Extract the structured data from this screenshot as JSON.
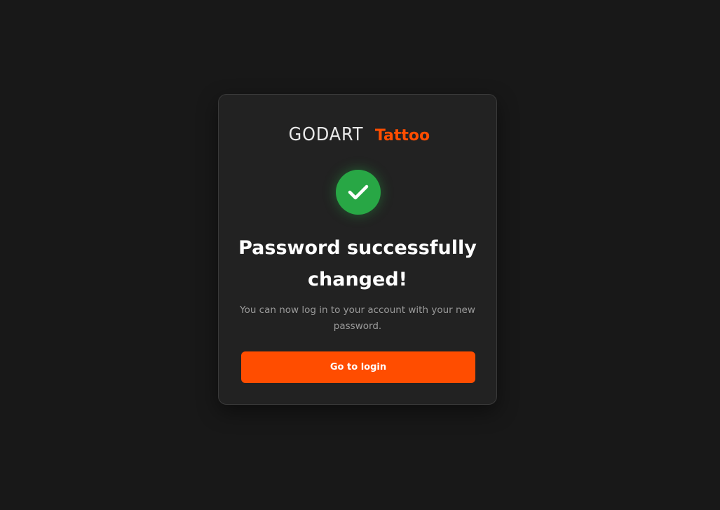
{
  "brand": {
    "name_part1": "GODART",
    "name_part2": "Tattoo",
    "accent_color": "#ff4d00"
  },
  "status": {
    "icon": "checkmark-icon",
    "color": "#28a745"
  },
  "message": {
    "title": "Password successfully changed!",
    "subtitle": "You can now log in to your account with your new password."
  },
  "actions": {
    "login_label": "Go to login"
  }
}
